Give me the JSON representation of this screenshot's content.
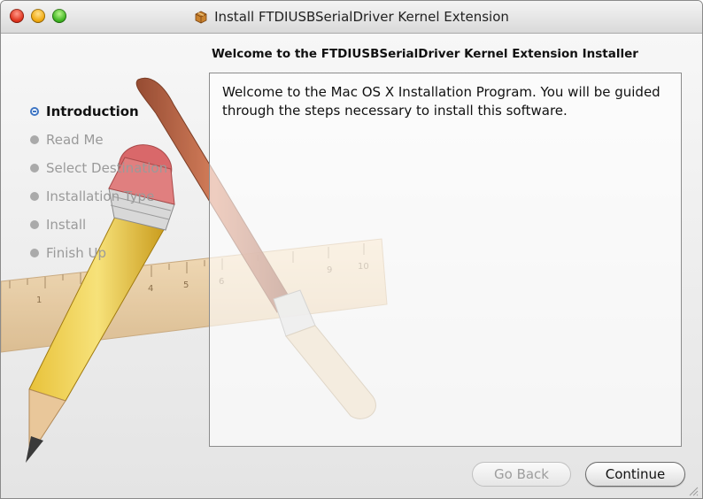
{
  "window": {
    "title": "Install FTDIUSBSerialDriver Kernel Extension",
    "title_icon": "package-icon"
  },
  "installer": {
    "heading": "Welcome to the FTDIUSBSerialDriver Kernel Extension Installer",
    "steps": [
      {
        "label": "Introduction",
        "active": true
      },
      {
        "label": "Read Me",
        "active": false
      },
      {
        "label": "Select Destination",
        "active": false
      },
      {
        "label": "Installation Type",
        "active": false
      },
      {
        "label": "Install",
        "active": false
      },
      {
        "label": "Finish Up",
        "active": false
      }
    ],
    "content_text": "Welcome to the Mac OS X Installation Program. You will be guided through the steps necessary to install this software.",
    "ruler_numbers": [
      "1",
      "4",
      "5",
      "6",
      "9",
      "10"
    ]
  },
  "buttons": {
    "go_back": "Go Back",
    "continue": "Continue"
  },
  "colors": {
    "active_bullet": "#3f76c4",
    "inactive_text": "#9a9a9a"
  }
}
